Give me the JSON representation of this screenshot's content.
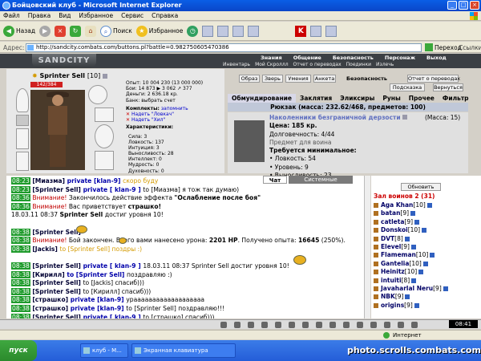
{
  "window": {
    "title": "Бойцовский клуб - Microsoft Internet Explorer",
    "btn_min": "_",
    "btn_max": "□",
    "btn_close": "×"
  },
  "menu": [
    "Файл",
    "Правка",
    "Вид",
    "Избранное",
    "Сервис",
    "Справка"
  ],
  "toolbar": {
    "back": "Назад",
    "search": "Поиск",
    "favorites": "Избранное"
  },
  "address": {
    "label": "Адрес:",
    "url": "http://sandcity.combats.com/buttons.pl?battle=0.982750605470386",
    "go": "Переход",
    "links": "Ссылки"
  },
  "game": {
    "logo": "SANDCITY",
    "nav_top": [
      "Знания",
      "Общение",
      "Безопасность",
      "Персонаж",
      "Выход"
    ],
    "nav_sub": [
      "Инвентарь",
      "Мой Скроллл",
      "Отчет о переводах",
      "Поединки",
      "Излечь"
    ]
  },
  "character": {
    "name": "Sprinter Sell",
    "level": "[10]",
    "hp": "142/384",
    "stats": [
      "Опыт: 10 004 230 (13 000 000)",
      "Бои: 14 873 ▶ 3 062 ↗ 377",
      "Деньги: 2 636.18 кр.",
      "Банк: выбрать счет"
    ],
    "sets_label": "Комплекты:",
    "sets_remember": "запомнить",
    "dress_1": "Надеть \"Ловкач\"",
    "dress_2": "Надеть \"Хил\"",
    "attrs_label": "Характеристики:",
    "attrs": [
      "Сила: 3",
      "Ловкость: 137",
      "Интуиция: 3",
      "Выносливость: 28",
      "Интеллект: 0",
      "Мудрость: 0",
      "Духовность: 0"
    ]
  },
  "actions": {
    "obraz": "Образ",
    "zver": "Зверь",
    "umeniya": "Умения",
    "anketa": "Анкета",
    "bezopasnost": "Безопасность",
    "otchet": "Отчет о переводах",
    "podskazka": "Подсказка",
    "vernutsya": "Вернуться"
  },
  "inventory": {
    "tabs": [
      "Обмундирование",
      "Заклятия",
      "Эликсиры",
      "Руны",
      "Прочее",
      "Фильтр"
    ],
    "bag": "Рюкзак (масса: 232.62/468, предметов: 100)",
    "item_title": "Наколенники безграничной дерзости",
    "item_mass": "(Масса: 15)",
    "item_lines": [
      "Цена: 185 кр.",
      "Долговечность: 4/44",
      "Предмет для воина",
      "Требуется минимальное:",
      "• Ловкость: 54",
      "• Уровень: 9",
      "• Выносливость: 23"
    ]
  },
  "chat_tabs": {
    "chat": "Чат",
    "system": "Системные сообщения"
  },
  "chat": [
    {
      "t": "08:23",
      "parts": [
        [
          "nm",
          "[Миазма] "
        ],
        [
          "pv",
          "private [klan-9] "
        ],
        [
          "gold",
          "скоро буду"
        ]
      ]
    },
    {
      "t": "08:23",
      "parts": [
        [
          "nm",
          "[Sprinter Sell] "
        ],
        [
          "pv",
          "private [ klan-9 ] "
        ],
        [
          "",
          "to [Миазма] я тож так думаю)"
        ]
      ]
    },
    {
      "t": "08:36",
      "parts": [
        [
          "red",
          "Внимание! "
        ],
        [
          "",
          "Закончилось действие эффекта "
        ],
        [
          "bold",
          "\"Ослабление после боя\""
        ]
      ]
    },
    {
      "t": "08:36",
      "parts": [
        [
          "red",
          "Внимание! "
        ],
        [
          "",
          "Вас приветствует "
        ],
        [
          "bold",
          "страшко!"
        ]
      ]
    },
    {
      "t": "18.03.11 08:37",
      "w": true,
      "parts": [
        [
          "bold",
          "Sprinter Sell "
        ],
        [
          "",
          "достиг уровня 10!"
        ]
      ]
    },
    {
      "t": "",
      "parts": []
    },
    {
      "t": "08:38",
      "parts": [
        [
          "nm",
          "[Sprinter Sell]"
        ]
      ]
    },
    {
      "t": "08:38",
      "parts": [
        [
          "red",
          "Внимание! "
        ],
        [
          "",
          "Бой закончен. Всего вами нанесено урона: "
        ],
        [
          "bold",
          "2201 HP"
        ],
        [
          "",
          ". Получено опыта: "
        ],
        [
          "bold",
          "16645"
        ],
        [
          "",
          " (250%)."
        ]
      ]
    },
    {
      "t": "08:38",
      "parts": [
        [
          "nm",
          "[Jackis] "
        ],
        [
          "gold",
          "to [Sprinter Sell] поздры :)"
        ]
      ]
    },
    {
      "t": "",
      "parts": []
    },
    {
      "t": "08:38",
      "parts": [
        [
          "nm",
          "[Sprinter Sell] "
        ],
        [
          "pv",
          "private [ klan-9 ] "
        ],
        [
          "",
          "18.03.11 08:37 Sprinter Sell достиг уровня 10!"
        ]
      ]
    },
    {
      "t": "08:38",
      "parts": [
        [
          "nm",
          "[Кирилл] "
        ],
        [
          "pv",
          "to [Sprinter Sell] "
        ],
        [
          "",
          "поздравляю :)"
        ]
      ]
    },
    {
      "t": "08:38",
      "parts": [
        [
          "nm",
          "[Sprinter Sell] "
        ],
        [
          "",
          "to [Jackis] спасиб)))"
        ]
      ]
    },
    {
      "t": "08:38",
      "parts": [
        [
          "nm",
          "[Sprinter Sell] "
        ],
        [
          "",
          "to [Кирилл] спасиб)))"
        ]
      ]
    },
    {
      "t": "08:38",
      "parts": [
        [
          "nm",
          "[страшко] "
        ],
        [
          "pv",
          "private [klan-9] "
        ],
        [
          "",
          "урааааааааааааааааааа"
        ]
      ]
    },
    {
      "t": "08:38",
      "parts": [
        [
          "nm",
          "[страшко] "
        ],
        [
          "pv",
          "private [klan-9] "
        ],
        [
          "",
          "to [Sprinter Sell] поздравляю!!!"
        ]
      ]
    },
    {
      "t": "08:38",
      "parts": [
        [
          "nm",
          "[Sprinter Sell] "
        ],
        [
          "pv",
          "private [ klan-9 ] "
        ],
        [
          "",
          "to [страшко] спасиб)))"
        ]
      ]
    }
  ],
  "users": {
    "refresh": "Обновить",
    "title": "Зал воинов 2 (31)",
    "list": [
      {
        "name": "Aga Khan",
        "lv": "[10]"
      },
      {
        "name": "batan",
        "lv": "[9]"
      },
      {
        "name": "catleta",
        "lv": "[9]"
      },
      {
        "name": "Donskoi",
        "lv": "[10]"
      },
      {
        "name": "DVT",
        "lv": "[8]"
      },
      {
        "name": "Elevel",
        "lv": "[9]"
      },
      {
        "name": "Flameman",
        "lv": "[10]"
      },
      {
        "name": "Gantelia",
        "lv": "[10]"
      },
      {
        "name": "Heinitz",
        "lv": "[10]"
      },
      {
        "name": "intuiti",
        "lv": "[8]"
      },
      {
        "name": "Javaharlal Neru",
        "lv": "[9]"
      },
      {
        "name": "NBK",
        "lv": "[9]"
      },
      {
        "name": "origins",
        "lv": "[9]"
      }
    ]
  },
  "clock": "08:41",
  "status": {
    "zone": "Интернет"
  },
  "taskbar": {
    "start": "пуск",
    "task1": "клуб - M...",
    "task2": "Экранная клавиатура"
  },
  "watermark": "photo.scrolls.combats.com"
}
